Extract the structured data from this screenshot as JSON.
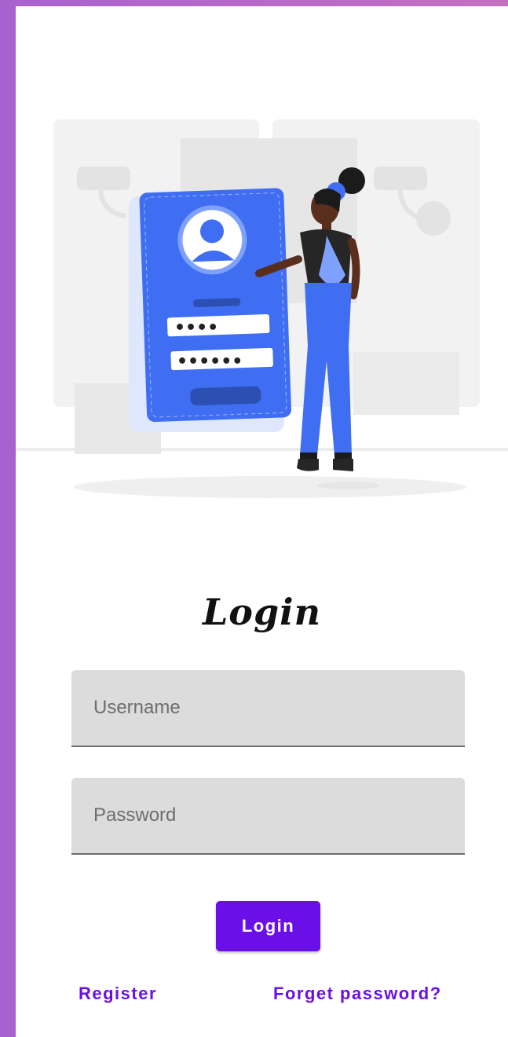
{
  "colors": {
    "accent": "#6a0fe8",
    "frame": "#a862cf",
    "illustration_blue": "#3f6ef2",
    "field_bg": "#dcdcdc"
  },
  "illustration": {
    "icon": "login-illustration-icon",
    "masked_username": "••••",
    "masked_password": "••••••"
  },
  "title": "Login",
  "form": {
    "username_placeholder": "Username",
    "password_placeholder": "Password",
    "login_label": "Login"
  },
  "links": {
    "register": "Register",
    "forget_password": "Forget password?"
  }
}
